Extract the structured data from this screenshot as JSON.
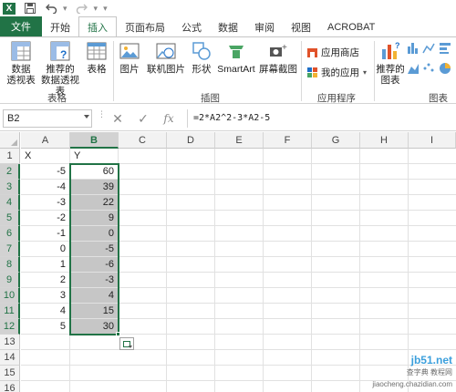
{
  "app": {
    "logo_letter": "X"
  },
  "tabs": [
    {
      "label": "文件",
      "active": false
    },
    {
      "label": "开始",
      "active": false
    },
    {
      "label": "插入",
      "active": true
    },
    {
      "label": "页面布局",
      "active": false
    },
    {
      "label": "公式",
      "active": false
    },
    {
      "label": "数据",
      "active": false
    },
    {
      "label": "审阅",
      "active": false
    },
    {
      "label": "视图",
      "active": false
    },
    {
      "label": "ACROBAT",
      "active": false
    }
  ],
  "ribbon": {
    "pivot_table": "数据\n透视表",
    "recommended_pivot": "推荐的\n数据透视表",
    "table": "表格",
    "tables_group": "表格",
    "picture": "图片",
    "online_picture": "联机图片",
    "shapes": "形状",
    "smartart": "SmartArt",
    "screenshot": "屏幕截图",
    "illustrations_group": "插图",
    "app_store": "应用商店",
    "my_apps": "我的应用",
    "apps_group": "应用程序",
    "recommended_charts": "推荐的\n图表",
    "charts_group": "图表"
  },
  "formula_bar": {
    "name_box": "B2",
    "fx_label": "fx",
    "formula": "=2*A2^2-3*A2-5"
  },
  "columns": [
    "A",
    "B",
    "C",
    "D",
    "E",
    "F",
    "G",
    "H",
    "I"
  ],
  "rows": [
    "1",
    "2",
    "3",
    "4",
    "5",
    "6",
    "7",
    "8",
    "9",
    "10",
    "11",
    "12",
    "13",
    "14",
    "15",
    "16"
  ],
  "headers": {
    "a1": "X",
    "b1": "Y"
  },
  "data": [
    {
      "x": "-5",
      "y": "60"
    },
    {
      "x": "-4",
      "y": "39"
    },
    {
      "x": "-3",
      "y": "22"
    },
    {
      "x": "-2",
      "y": "9"
    },
    {
      "x": "-1",
      "y": "0"
    },
    {
      "x": "0",
      "y": "-5"
    },
    {
      "x": "1",
      "y": "-6"
    },
    {
      "x": "2",
      "y": "-3"
    },
    {
      "x": "3",
      "y": "4"
    },
    {
      "x": "4",
      "y": "15"
    },
    {
      "x": "5",
      "y": "30"
    }
  ],
  "watermark": {
    "line1": "jb51.net",
    "line2": "查字典 教程网",
    "line3": "jiaocheng.chazidian.com"
  },
  "colors": {
    "excel_green": "#217346",
    "selection_fill": "#c6c6c6"
  }
}
